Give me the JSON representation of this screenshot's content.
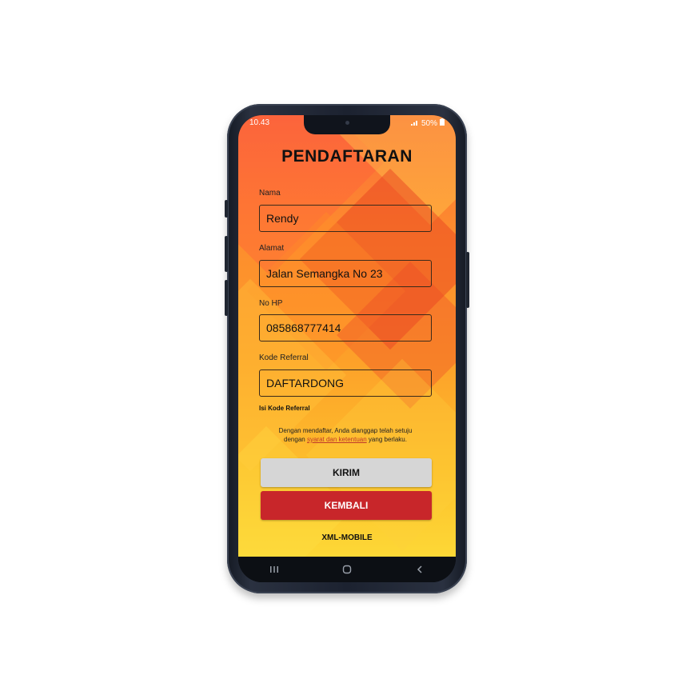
{
  "statusbar": {
    "time": "10.43",
    "signal_icon": "signal-icon",
    "battery": "50%"
  },
  "page": {
    "title": "PENDAFTARAN"
  },
  "form": {
    "fields": [
      {
        "label": "Nama",
        "value": "Rendy"
      },
      {
        "label": "Alamat",
        "value": "Jalan Semangka No 23"
      },
      {
        "label": "No HP",
        "value": "085868777414"
      },
      {
        "label": "Kode Referral",
        "value": "DAFTARDONG"
      }
    ],
    "hint": "Isi Kode Referral"
  },
  "terms": {
    "line1": "Dengan mendaftar, Anda dianggap telah setuju",
    "prefix": "dengan",
    "link": "syarat dan ketentuan",
    "suffix": "yang berlaku."
  },
  "buttons": {
    "submit": "KIRIM",
    "back": "KEMBALI"
  },
  "footer": {
    "brand": "XML-MOBILE"
  },
  "navbar": {
    "recents_icon": "recents-icon",
    "home_icon": "home-icon",
    "back_icon": "back-icon"
  },
  "colors": {
    "kembali": "#c8262a",
    "kirim": "#d6d6d6",
    "background_top": "#fb6a3c",
    "background_bottom": "#fdd836"
  }
}
